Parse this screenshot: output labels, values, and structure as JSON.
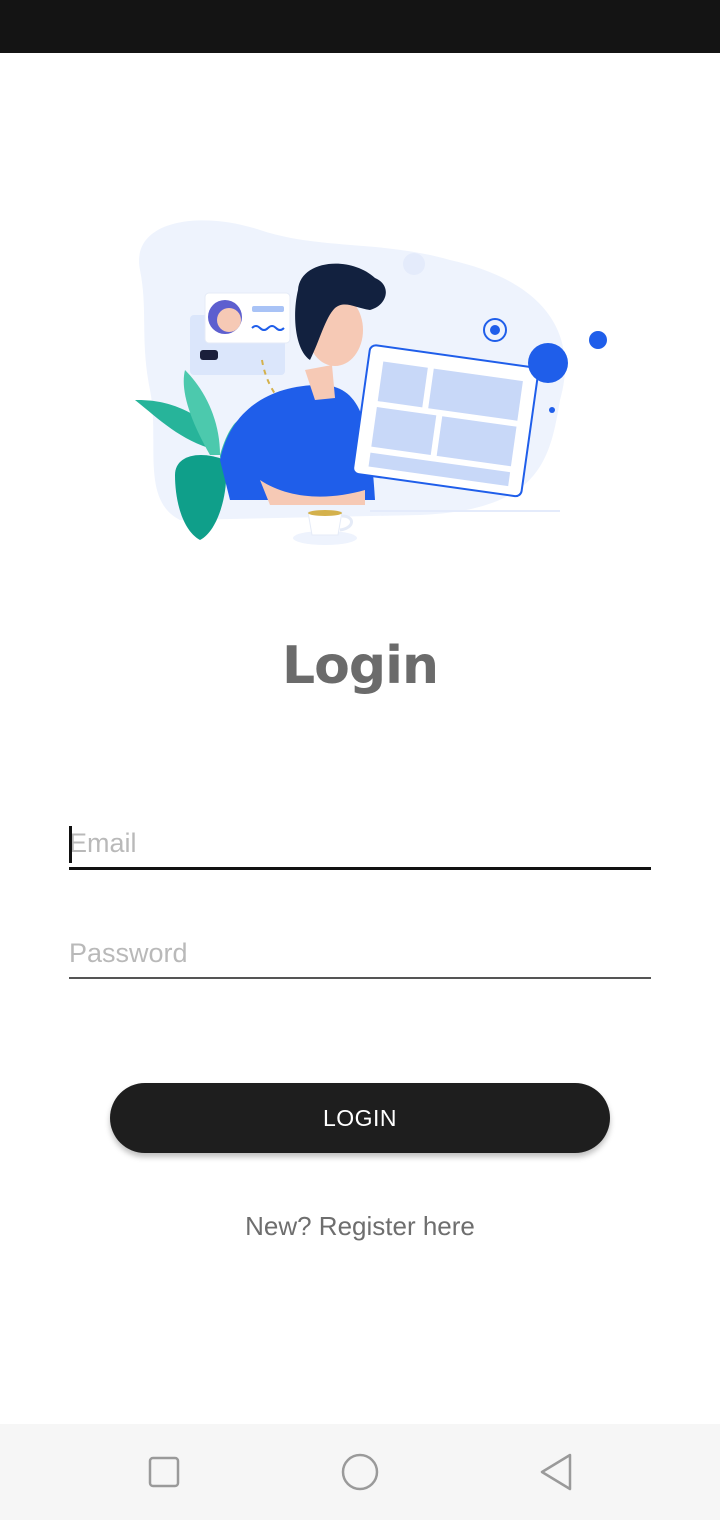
{
  "title": "Login",
  "email": {
    "placeholder": "Email",
    "value": ""
  },
  "password": {
    "placeholder": "Password",
    "value": ""
  },
  "login_button": {
    "label": "LOGIN"
  },
  "register_link": {
    "label": "New? Register here"
  },
  "colors": {
    "status_bar": "#141414",
    "title_text": "#6b6b6b",
    "button_bg": "#1e1e1e",
    "button_text": "#ffffff",
    "illustration_accent": "#1f5eea",
    "illustration_plant": "#1aa58c",
    "nav_bar": "#f6f6f6"
  },
  "icons": {
    "hero": "person-working-at-tablet-illustration",
    "nav": [
      "recent-apps-icon",
      "home-icon",
      "back-icon"
    ]
  }
}
